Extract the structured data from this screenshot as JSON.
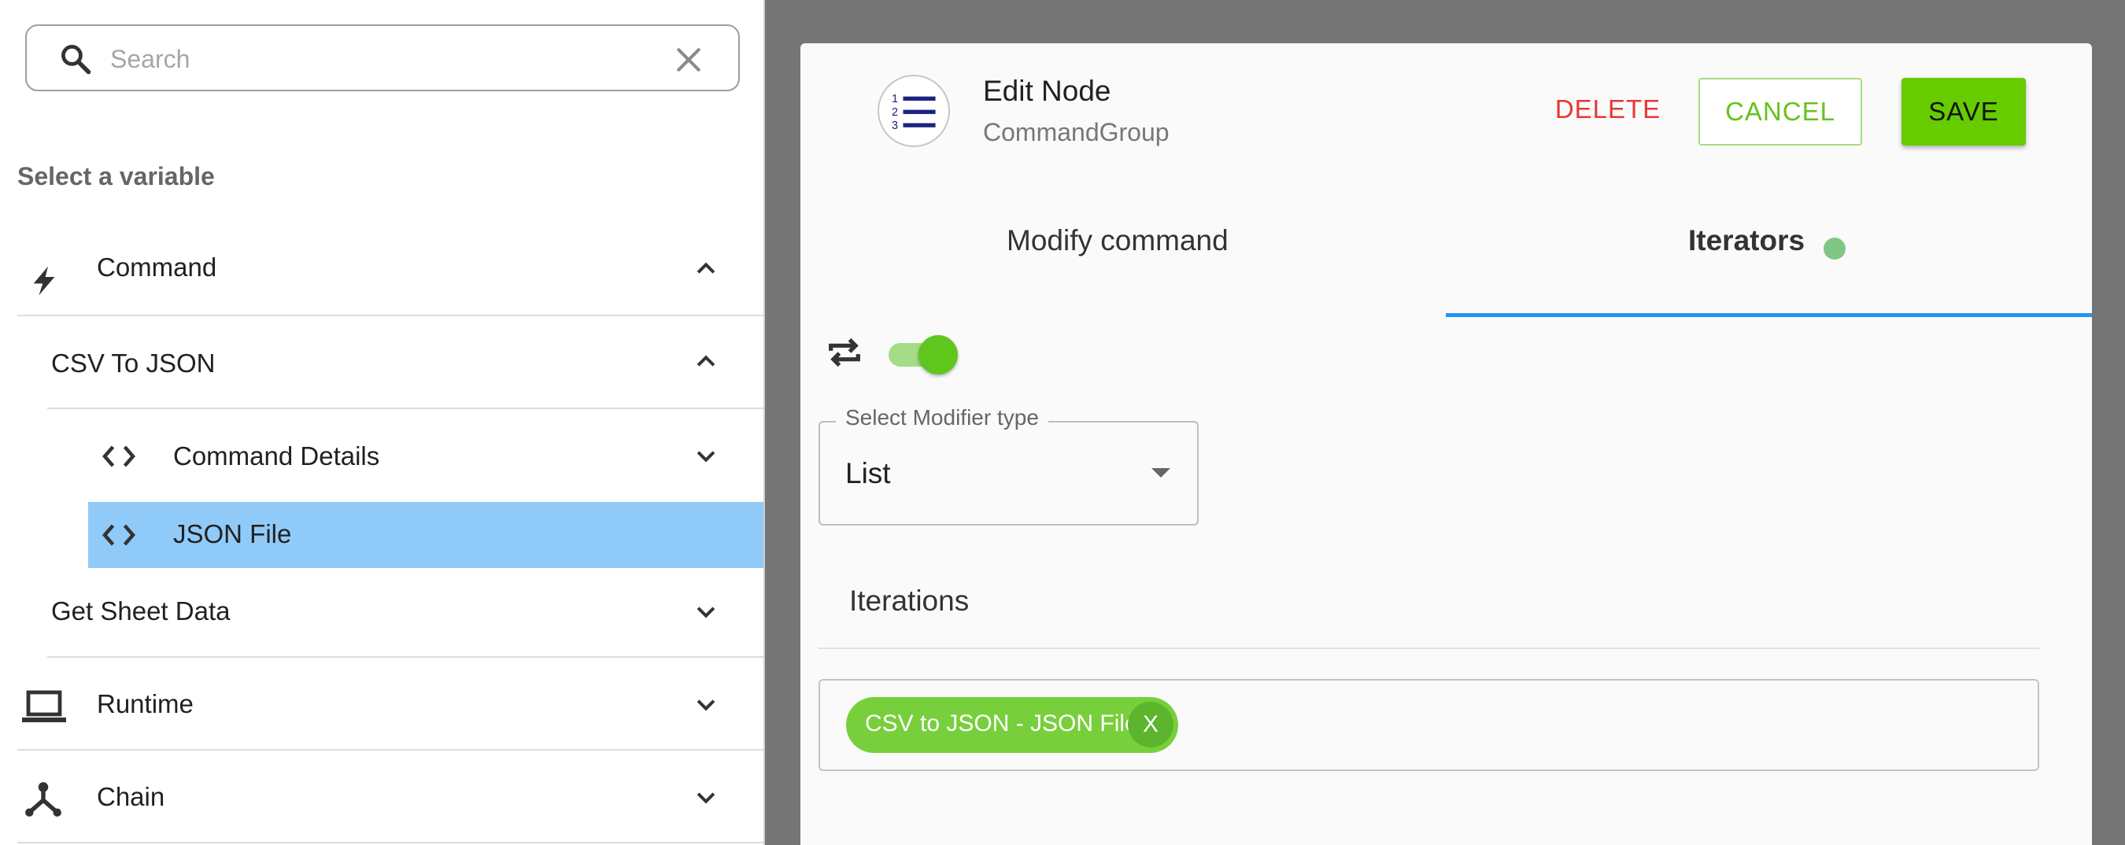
{
  "search": {
    "placeholder": "Search",
    "value": ""
  },
  "sidebar": {
    "heading": "Select a variable",
    "items": [
      {
        "label": "Command",
        "icon": "lightning-icon",
        "chevron": "up"
      },
      {
        "label": "CSV To JSON",
        "chevron": "up"
      },
      {
        "label": "Command Details",
        "icon": "code-icon",
        "chevron": "down"
      },
      {
        "label": "JSON File",
        "icon": "code-icon",
        "selected": true
      },
      {
        "label": "Get Sheet Data",
        "chevron": "down"
      },
      {
        "label": "Runtime",
        "icon": "laptop-icon",
        "chevron": "down"
      },
      {
        "label": "Chain",
        "icon": "chain-icon",
        "chevron": "down"
      }
    ]
  },
  "dialog": {
    "title": "Edit Node",
    "subtitle": "CommandGroup",
    "delete_label": "DELETE",
    "cancel_label": "CANCEL",
    "save_label": "SAVE",
    "tabs": [
      {
        "label": "Modify command",
        "active": false
      },
      {
        "label": "Iterators",
        "active": true,
        "indicator_color": "#81c784"
      }
    ],
    "toggle_on": true,
    "modifier": {
      "legend": "Select Modifier type",
      "value": "List"
    },
    "iterations_title": "Iterations",
    "chips": [
      {
        "label": "CSV to JSON - JSON File",
        "remove_label": "X"
      }
    ]
  },
  "colors": {
    "accent_green": "#66cc00",
    "delete_red": "#e53935",
    "tab_underline": "#2196f3",
    "selected_row": "#90caf9",
    "overlay": "#757575"
  }
}
